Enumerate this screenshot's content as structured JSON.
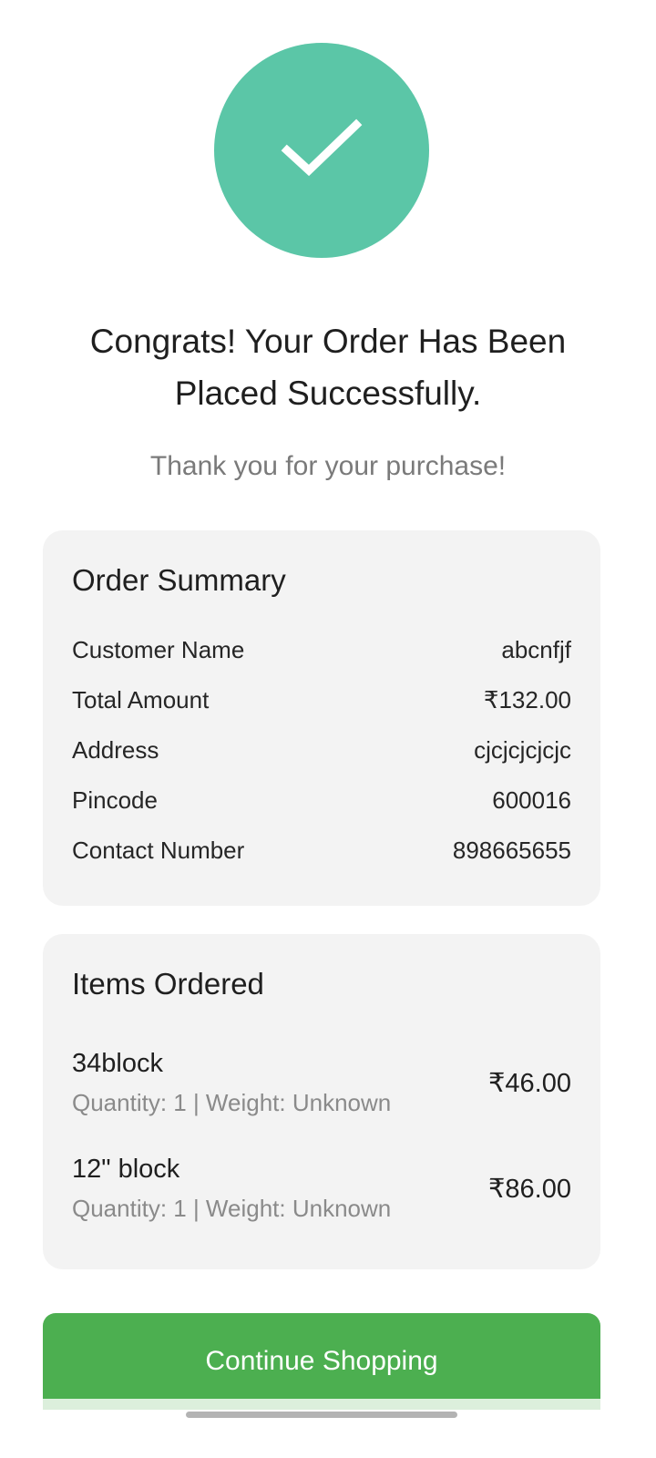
{
  "success": {
    "icon": "check-icon",
    "circle_color": "#5bc6a7"
  },
  "headline": {
    "line1": "Congrats! Your Order Has Been",
    "line2": "Placed Successfully."
  },
  "subline": "Thank you for your purchase!",
  "summary": {
    "title": "Order Summary",
    "rows": [
      {
        "label": "Customer Name",
        "value": "abcnfjf"
      },
      {
        "label": "Total Amount",
        "value": "₹132.00"
      },
      {
        "label": "Address",
        "value": "cjcjcjcjcjc"
      },
      {
        "label": "Pincode",
        "value": "600016"
      },
      {
        "label": "Contact Number",
        "value": "898665655"
      }
    ]
  },
  "items": {
    "title": "Items Ordered",
    "list": [
      {
        "name": "34block",
        "meta": "Quantity: 1 | Weight: Unknown",
        "price": "₹46.00"
      },
      {
        "name": "12\" block",
        "meta": "Quantity: 1 | Weight: Unknown",
        "price": "₹86.00"
      }
    ]
  },
  "actions": {
    "continue_label": "Continue Shopping",
    "button_color": "#4caf50"
  }
}
